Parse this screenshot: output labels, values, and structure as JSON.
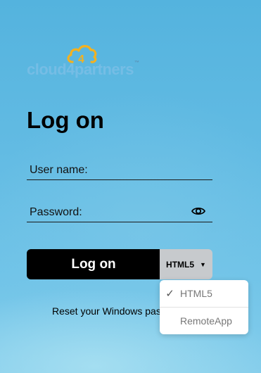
{
  "brand": {
    "logo_text": "cloud4partners",
    "trademark": "™"
  },
  "form": {
    "title": "Log on",
    "username_placeholder": "User name:",
    "password_placeholder": "Password:",
    "logon_label": "Log on",
    "mode_selected": "HTML5",
    "reset_text": "Reset your Windows pas"
  },
  "mode_menu": {
    "items": [
      {
        "label": "HTML5",
        "checked": true,
        "check_glyph": "✓"
      },
      {
        "label": "RemoteApp",
        "checked": false,
        "check_glyph": ""
      }
    ]
  },
  "icons": {
    "eye": "eye-icon",
    "caret": "caret-down-icon",
    "cloud": "cloud-logo-icon"
  },
  "colors": {
    "background": "#5fb9e2",
    "button": "#000000",
    "mode_button": "#c7cacd",
    "logo_orange": "#f3b120"
  }
}
